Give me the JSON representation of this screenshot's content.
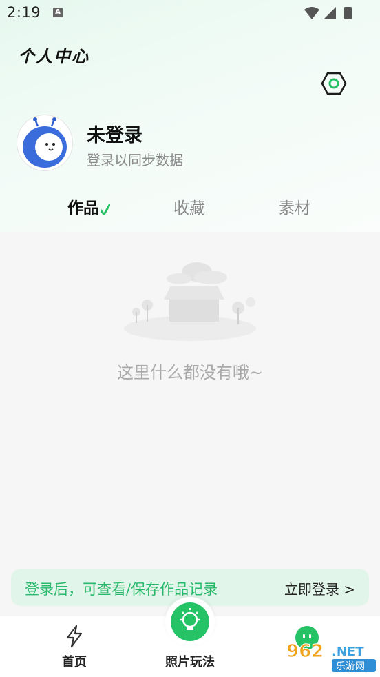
{
  "status_bar": {
    "time": "2:19",
    "notification_glyph": "A"
  },
  "header": {
    "title": "个人中心"
  },
  "profile": {
    "name": "未登录",
    "subtitle": "登录以同步数据"
  },
  "tabs": [
    {
      "label": "作品",
      "active": true
    },
    {
      "label": "收藏",
      "active": false
    },
    {
      "label": "素材",
      "active": false
    }
  ],
  "empty_state": {
    "text": "这里什么都没有哦~"
  },
  "login_banner": {
    "tip": "登录后，可查看/保存作品记录",
    "action": "立即登录 >"
  },
  "bottom_nav": [
    {
      "label": "首页",
      "icon": "lightning-icon"
    },
    {
      "label": "照片玩法",
      "icon": "lightbulb-icon"
    },
    {
      "label": "",
      "icon": "mine-face-icon"
    }
  ],
  "watermark": {
    "number": "962",
    "suffix": ".NET",
    "site": "乐游网"
  },
  "colors": {
    "accent": "#25c266",
    "banner_bg": "#e2f5eb",
    "banner_text": "#28b96b"
  }
}
